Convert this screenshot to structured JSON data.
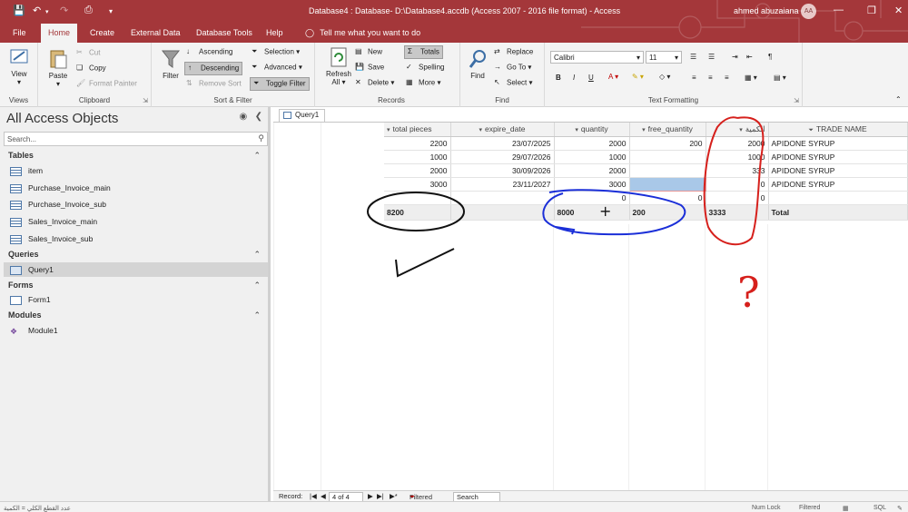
{
  "titlebar": {
    "title": "Database4 : Database- D:\\Database4.accdb (Access 2007 - 2016 file format)  -  Access",
    "user": "ahmed abuzaiana",
    "avatar": "AA"
  },
  "menu": {
    "tabs": [
      "File",
      "Home",
      "Create",
      "External Data",
      "Database Tools",
      "Help"
    ],
    "active": "Home",
    "tell_me": "Tell me what you want to do"
  },
  "ribbon": {
    "views": {
      "view": "View",
      "label": "Views"
    },
    "clipboard": {
      "paste": "Paste",
      "cut": "Cut",
      "copy": "Copy",
      "format_painter": "Format Painter",
      "label": "Clipboard"
    },
    "sort_filter": {
      "filter": "Filter",
      "ascending": "Ascending",
      "descending": "Descending",
      "remove_sort": "Remove Sort",
      "selection": "Selection",
      "advanced": "Advanced",
      "toggle_filter": "Toggle Filter",
      "label": "Sort & Filter"
    },
    "records": {
      "refresh": "Refresh",
      "refresh_all": "All",
      "new": "New",
      "save": "Save",
      "delete": "Delete",
      "totals": "Totals",
      "spelling": "Spelling",
      "more": "More",
      "label": "Records"
    },
    "find": {
      "find": "Find",
      "replace": "Replace",
      "go_to": "Go To",
      "select": "Select",
      "label": "Find"
    },
    "text_formatting": {
      "font": "Calibri",
      "size": "11",
      "bold": "B",
      "italic": "I",
      "underline": "U",
      "label": "Text Formatting"
    }
  },
  "nav": {
    "title": "All Access Objects",
    "search_placeholder": "Search...",
    "sections": [
      {
        "name": "Tables",
        "items": [
          "item",
          "Purchase_Invoice_main",
          "Purchase_Invoice_sub",
          "Sales_Invoice_main",
          "Sales_Invoice_sub"
        ]
      },
      {
        "name": "Queries",
        "items": [
          "Query1"
        ]
      },
      {
        "name": "Forms",
        "items": [
          "Form1"
        ]
      },
      {
        "name": "Modules",
        "items": [
          "Module1"
        ]
      }
    ]
  },
  "document": {
    "tab": "Query1",
    "columns": [
      "total pieces",
      "expire_date",
      "quantity",
      "free_quantity",
      "الكمية",
      "TRADE NAME"
    ],
    "rows": [
      [
        "2200",
        "23/07/2025",
        "2000",
        "200",
        "2000",
        "APIDONE SYRUP"
      ],
      [
        "1000",
        "29/07/2026",
        "1000",
        "",
        "1000",
        "APIDONE SYRUP"
      ],
      [
        "2000",
        "30/09/2026",
        "2000",
        "",
        "333",
        "APIDONE SYRUP"
      ],
      [
        "3000",
        "23/11/2027",
        "3000",
        "",
        "0",
        "APIDONE SYRUP"
      ],
      [
        "",
        "",
        "0",
        "0",
        "0",
        ""
      ]
    ],
    "totals": [
      "8200",
      "",
      "8000",
      "200",
      "3333",
      "Total"
    ]
  },
  "record_bar": {
    "label": "Record:",
    "position": "4 of 4",
    "filtered": "Filtered",
    "search": "Search"
  },
  "status": {
    "left": "عدد القطع الكلي = الكمية",
    "num_lock": "Num Lock",
    "filtered": "Filtered",
    "sql": "SQL"
  },
  "colors": {
    "brand": "#a4373a",
    "highlight_header": "#fff3b0",
    "selected_cell": "#a9c8e8"
  },
  "annotations": {
    "icons": [
      "black-ellipse",
      "checkmark",
      "blue-ellipse",
      "plus-sign",
      "red-ellipse",
      "question-mark"
    ],
    "plus": "+",
    "question": "?"
  }
}
